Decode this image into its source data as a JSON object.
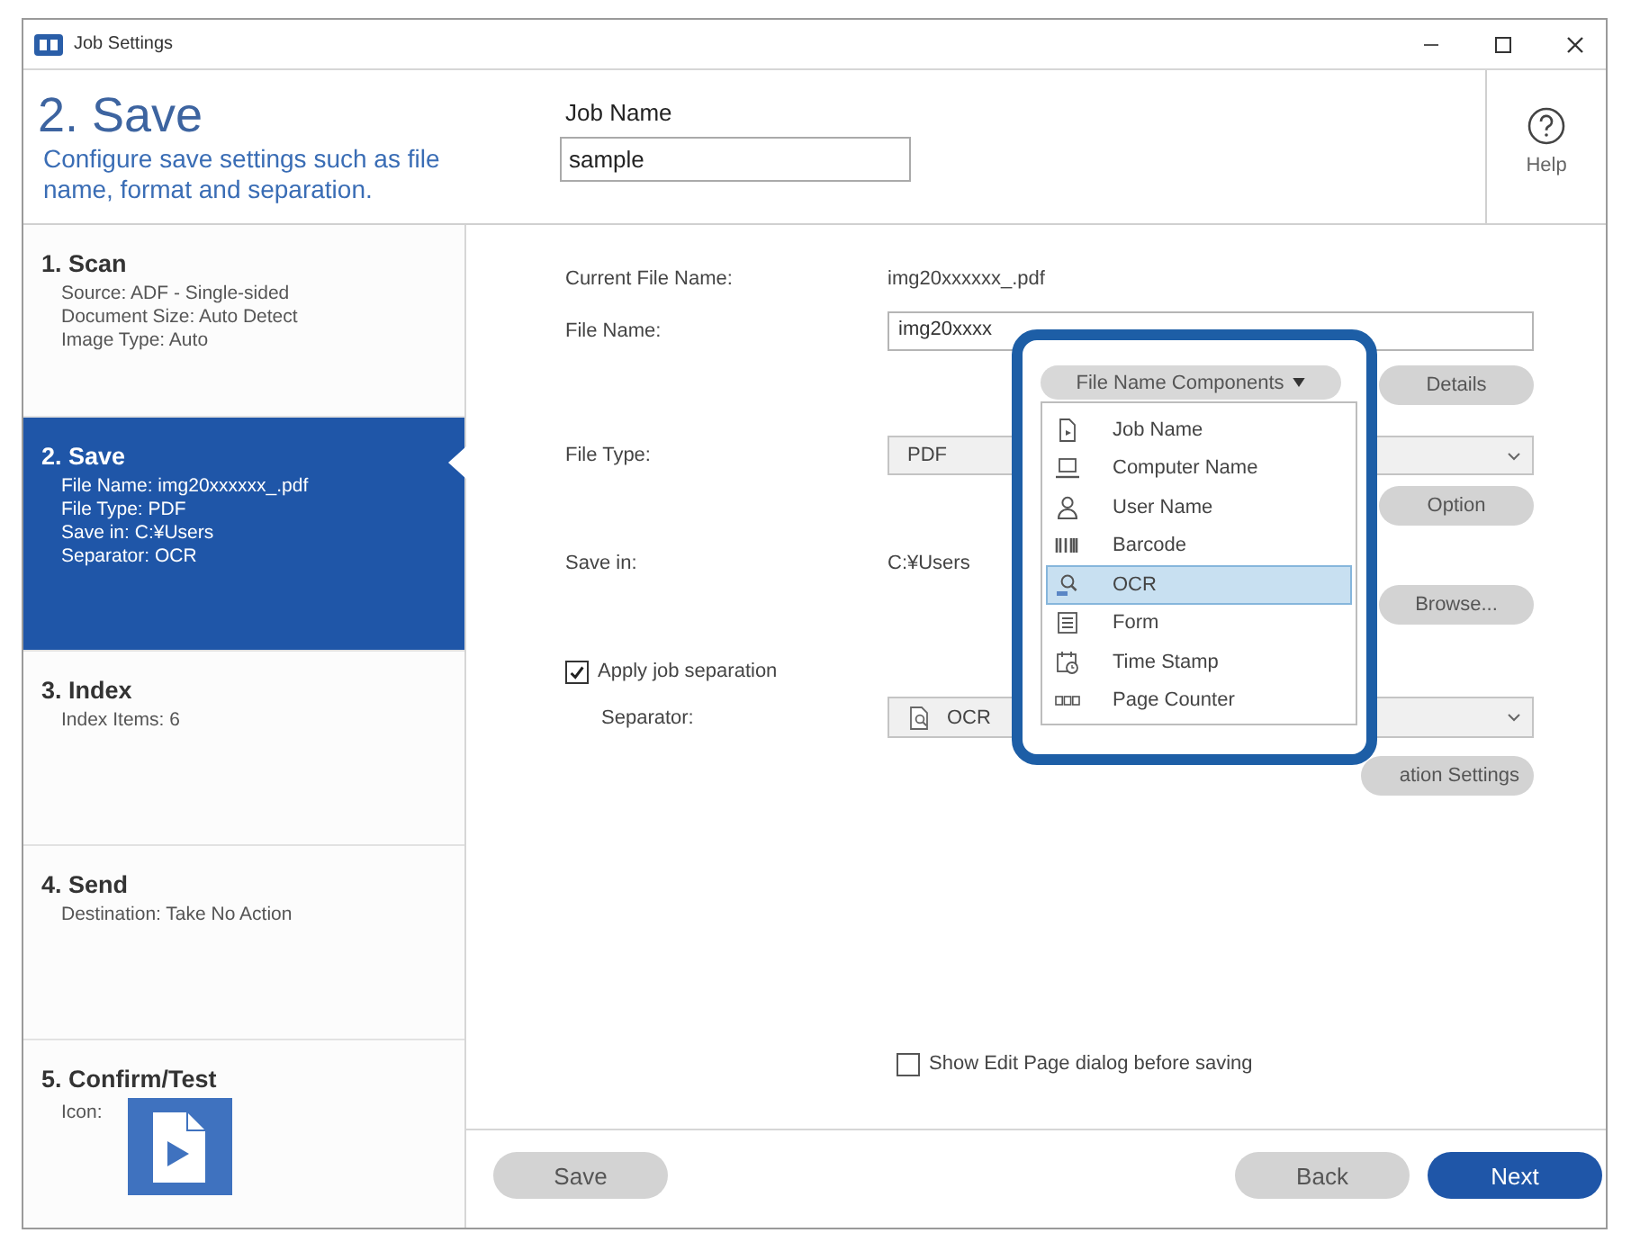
{
  "window": {
    "title": "Job Settings"
  },
  "header": {
    "step_title": "2. Save",
    "description": "Configure save settings such as file name, format and separation.",
    "job_name": {
      "label": "Job Name",
      "value": "sample"
    },
    "help": "Help"
  },
  "steps": [
    {
      "title": "1. Scan",
      "kind": "summary",
      "lines": [
        "Source: ADF - Single-sided",
        "Document Size: Auto Detect",
        "Image Type: Auto"
      ],
      "selected": false
    },
    {
      "title": "2. Save",
      "kind": "summary",
      "lines": [
        "File Name: img20xxxxxx_.pdf",
        "File Type: PDF",
        "Save in: C:¥Users",
        "Separator: OCR"
      ],
      "selected": true
    },
    {
      "title": "3. Index",
      "kind": "summary",
      "lines": [
        "Index Items: 6"
      ],
      "selected": false
    },
    {
      "title": "4. Send",
      "kind": "summary",
      "lines": [
        "Destination: Take No Action"
      ],
      "selected": false
    },
    {
      "title": "5. Confirm/Test",
      "kind": "icon",
      "lines": [
        "Icon:"
      ],
      "selected": false
    }
  ],
  "form": {
    "current_file_name": {
      "label": "Current File Name:",
      "value": "img20xxxxxx_.pdf"
    },
    "file_name": {
      "label": "File Name:",
      "value": "img20xxxx"
    },
    "details_button": "Details",
    "file_type": {
      "label": "File Type:",
      "value": "PDF"
    },
    "option_button": "Option",
    "save_in": {
      "label": "Save in:",
      "value": "C:¥Users"
    },
    "browse_button": "Browse...",
    "apply_job_separation": {
      "label": "Apply job separation",
      "checked": true
    },
    "separator": {
      "label": "Separator:",
      "value": "OCR"
    },
    "separation_settings_button": "ation Settings",
    "show_edit_page": {
      "label": "Show Edit Page dialog before saving",
      "checked": false
    }
  },
  "components_menu": {
    "button": "File Name Components",
    "items": [
      {
        "label": "Job Name",
        "kind": "job",
        "selected": false
      },
      {
        "label": "Computer Name",
        "kind": "computer",
        "selected": false
      },
      {
        "label": "User Name",
        "kind": "user",
        "selected": false
      },
      {
        "label": "Barcode",
        "kind": "barcode",
        "selected": false
      },
      {
        "label": "OCR",
        "kind": "ocr",
        "selected": true
      },
      {
        "label": "Form",
        "kind": "form",
        "selected": false
      },
      {
        "label": "Time Stamp",
        "kind": "timestamp",
        "selected": false
      },
      {
        "label": "Page Counter",
        "kind": "counter",
        "selected": false
      }
    ]
  },
  "footer": {
    "save_button": "Save",
    "back_button": "Back",
    "next_button": "Next"
  }
}
